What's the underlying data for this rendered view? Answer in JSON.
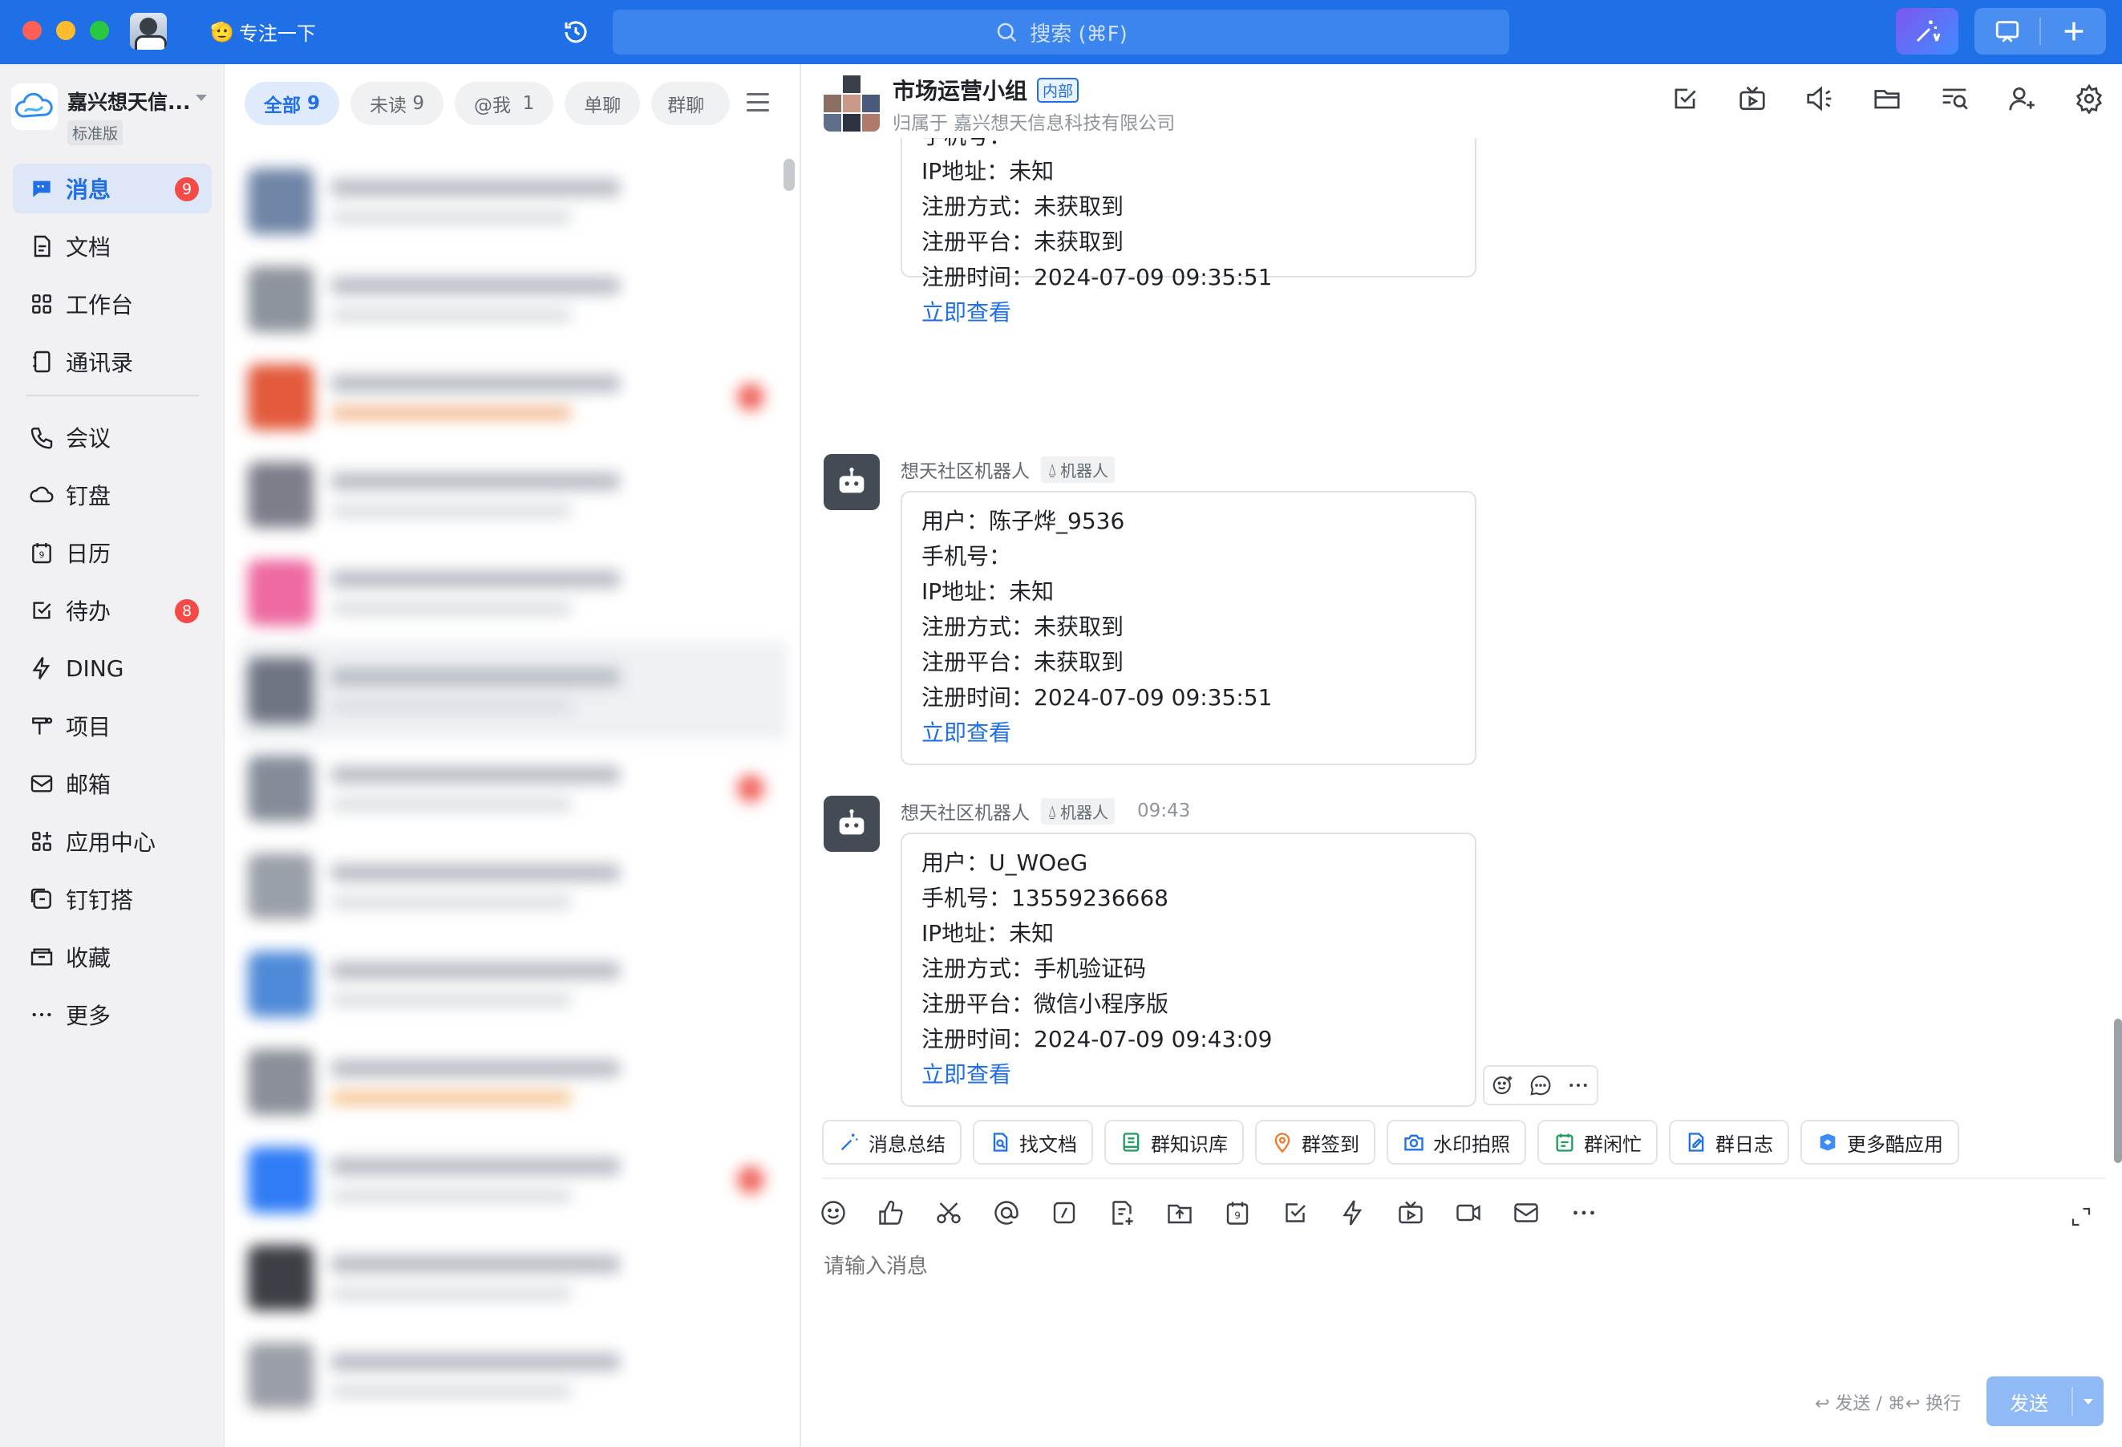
{
  "titlebar": {
    "status_text": "专注一下",
    "search_placeholder": "搜索 (⌘F)"
  },
  "sidebar": {
    "org_name": "嘉兴想天信...",
    "org_plan": "标准版",
    "items": [
      {
        "label": "消息",
        "badge": "9",
        "icon": "message-icon"
      },
      {
        "label": "文档",
        "icon": "document-icon"
      },
      {
        "label": "工作台",
        "icon": "workbench-icon"
      },
      {
        "label": "通讯录",
        "icon": "contacts-icon"
      },
      {
        "label": "会议",
        "icon": "meeting-icon"
      },
      {
        "label": "钉盘",
        "icon": "cloud-drive-icon"
      },
      {
        "label": "日历",
        "icon": "calendar-icon"
      },
      {
        "label": "待办",
        "badge": "8",
        "icon": "todo-icon"
      },
      {
        "label": "DING",
        "icon": "ding-icon"
      },
      {
        "label": "项目",
        "icon": "project-icon"
      },
      {
        "label": "邮箱",
        "icon": "mail-icon"
      },
      {
        "label": "应用中心",
        "icon": "app-center-icon"
      },
      {
        "label": "钉钉搭",
        "icon": "lowcode-icon"
      },
      {
        "label": "收藏",
        "icon": "favorites-icon"
      },
      {
        "label": "更多",
        "icon": "more-icon"
      }
    ]
  },
  "conv_filters": {
    "all": "全部",
    "all_count": "9",
    "unread": "未读",
    "unread_count": "9",
    "mention": "@我",
    "mention_count": "1",
    "single": "单聊",
    "group": "群聊"
  },
  "chat": {
    "title": "市场运营小组",
    "tag": "内部",
    "subtitle": "归属于 嘉兴想天信息科技有限公司",
    "messages": [
      {
        "lines": [
          "手机号：",
          "IP地址：未知",
          "注册方式：未获取到",
          "注册平台：未获取到",
          "注册时间：2024-07-09 09:35:51"
        ],
        "link": "立即查看"
      },
      {
        "sender": "想天社区机器人",
        "bot_tag": "机器人",
        "lines": [
          "用户：陈子烨_9536",
          "手机号：",
          "IP地址：未知",
          "注册方式：未获取到",
          "注册平台：未获取到",
          "注册时间：2024-07-09 09:35:51"
        ],
        "link": "立即查看"
      },
      {
        "sender": "想天社区机器人",
        "bot_tag": "机器人",
        "time": "09:43",
        "lines": [
          "用户：U_WOeG",
          "手机号：13559236668",
          "IP地址：未知",
          "注册方式：手机验证码",
          "注册平台：微信小程序版",
          "注册时间：2024-07-09 09:43:09"
        ],
        "link": "立即查看"
      }
    ],
    "quick_actions": [
      "消息总结",
      "找文档",
      "群知识库",
      "群签到",
      "水印拍照",
      "群闲忙",
      "群日志",
      "更多酷应用"
    ],
    "input_placeholder": "请输入消息",
    "send_hint": "↩ 发送 / ⌘↩ 换行",
    "send_label": "发送"
  }
}
